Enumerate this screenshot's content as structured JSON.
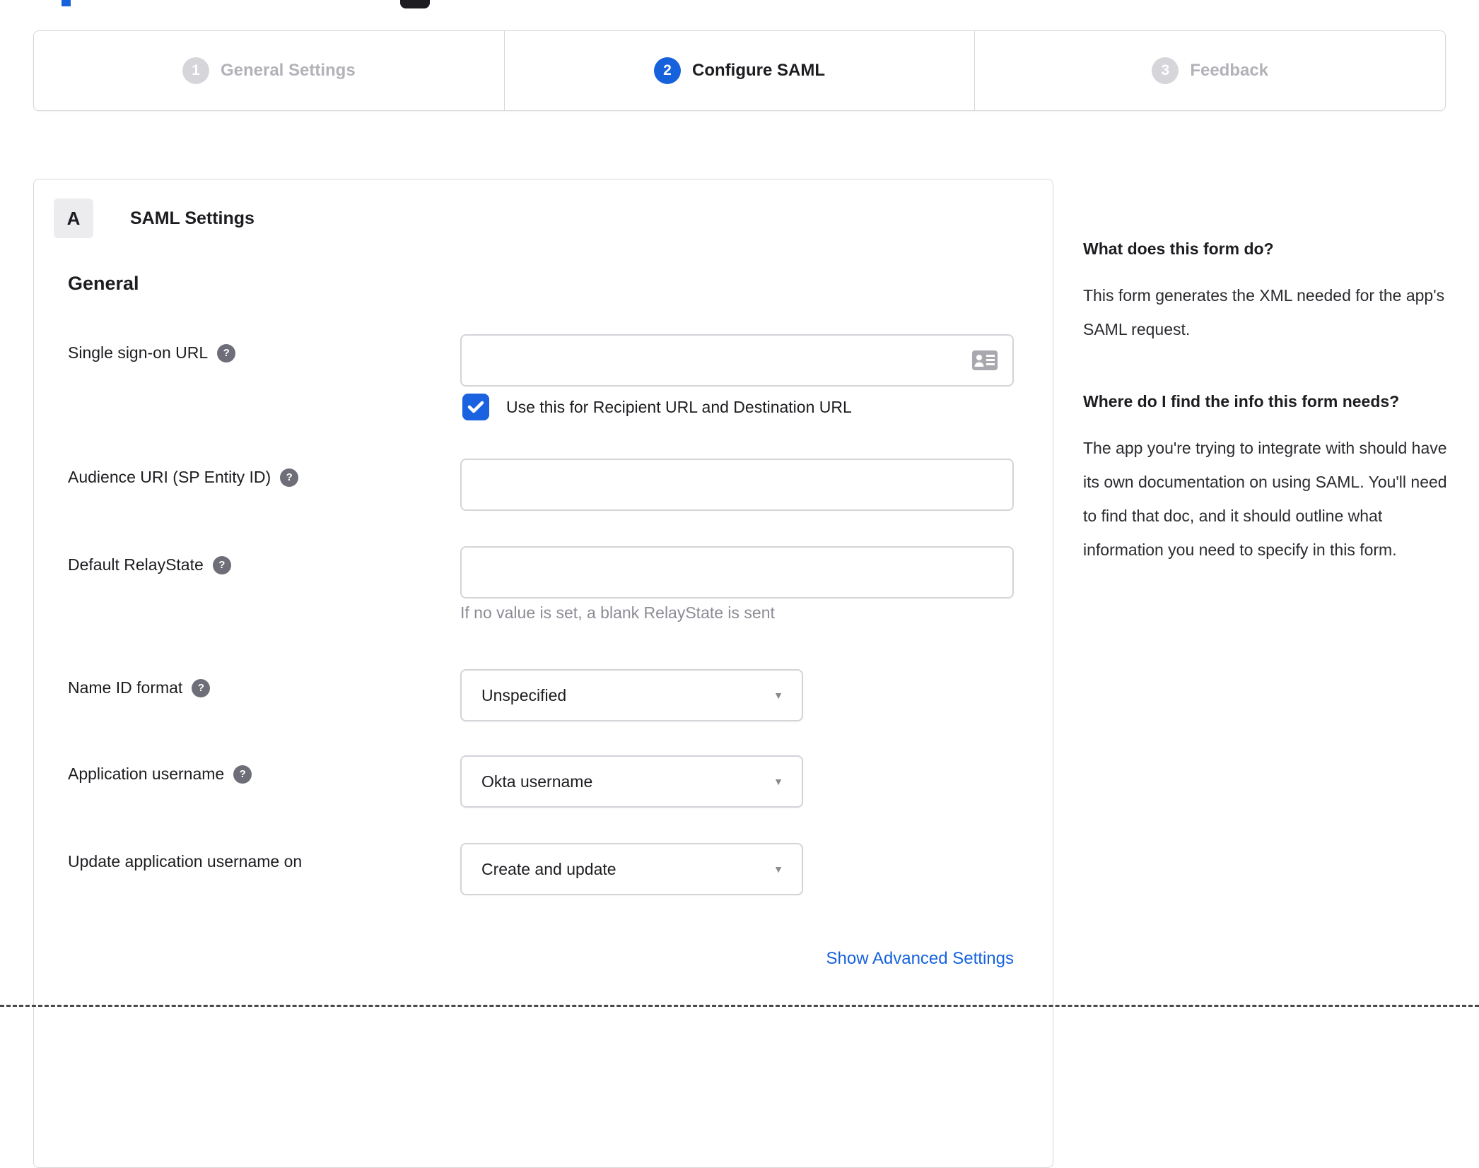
{
  "colors": {
    "accent_blue": "#1662dd",
    "checkbox_blue": "#1a62e0",
    "inactive_gray": "#d6d6da",
    "inactive_label_gray": "#b2b2b8",
    "text_dark": "#1d1d21",
    "hint_gray": "#8c8c96",
    "border_gray": "#d8d8dc",
    "help_icon_gray": "#6e6e78"
  },
  "icons": {
    "help_glyph": "?",
    "chevron_down_glyph": "▼",
    "sso_input_icon": "contact-card-icon",
    "checkbox_icon": "checkmark-icon"
  },
  "stepper": {
    "steps": [
      {
        "number": "1",
        "label": "General Settings",
        "state": "inactive"
      },
      {
        "number": "2",
        "label": "Configure SAML",
        "state": "active"
      },
      {
        "number": "3",
        "label": "Feedback",
        "state": "inactive"
      }
    ]
  },
  "panel": {
    "section_badge": "A",
    "section_title": "SAML Settings",
    "group_heading": "General",
    "fields": {
      "sso_url": {
        "label": "Single sign-on URL",
        "value": "",
        "has_help": true
      },
      "sso_checkbox": {
        "label": "Use this for Recipient URL and Destination URL",
        "checked": true
      },
      "audience_uri": {
        "label": "Audience URI (SP Entity ID)",
        "value": "",
        "has_help": true
      },
      "relay_state": {
        "label": "Default RelayState",
        "value": "",
        "hint": "If no value is set, a blank RelayState is sent",
        "has_help": true
      },
      "name_id_format": {
        "label": "Name ID format",
        "value": "Unspecified",
        "has_help": true
      },
      "app_username": {
        "label": "Application username",
        "value": "Okta username",
        "has_help": true
      },
      "update_username": {
        "label": "Update application username on",
        "value": "Create and update",
        "has_help": false
      }
    },
    "advanced_link_label": "Show Advanced Settings"
  },
  "sidebar": {
    "section1": {
      "heading": "What does this form do?",
      "body": "This form generates the XML needed for the app's SAML request."
    },
    "section2": {
      "heading": "Where do I find the info this form needs?",
      "body": "The app you're trying to integrate with should have its own documentation on using SAML. You'll need to find that doc, and it should outline what information you need to specify in this form."
    }
  }
}
